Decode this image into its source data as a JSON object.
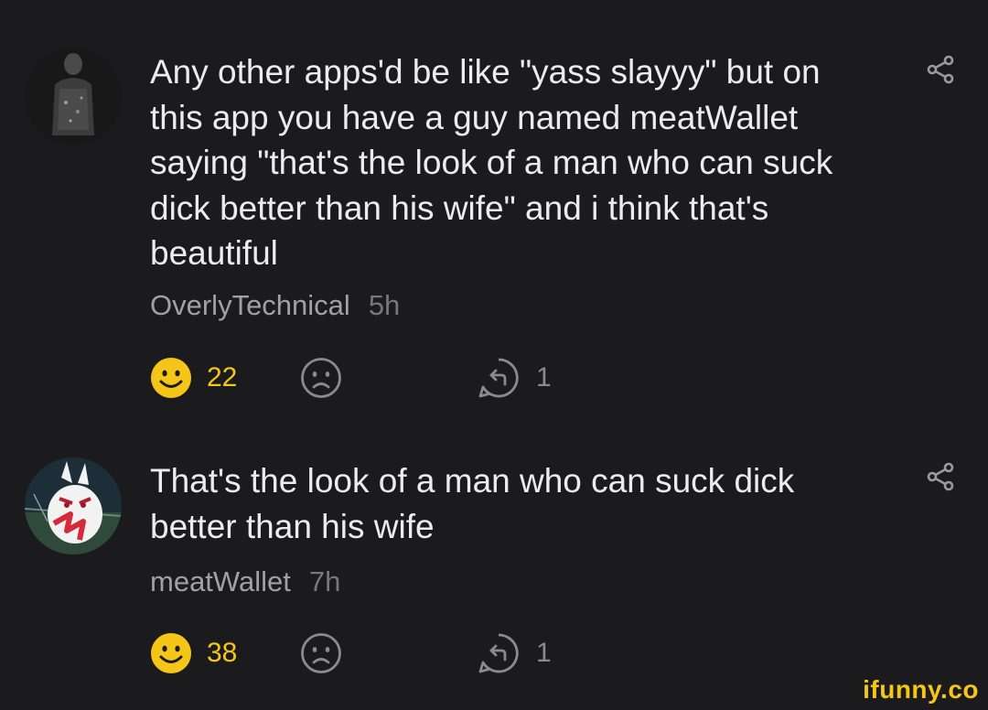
{
  "comments": [
    {
      "text": "Any other apps'd be like \"yass slayyy\" but on this app you have a guy named meatWallet saying \"that's the look of a man who can suck dick better than his wife\" and i think that's beautiful",
      "author": "OverlyTechnical",
      "time": "5h",
      "likes": "22",
      "replies": "1"
    },
    {
      "text": "That's the look of a man who can suck dick better than his wife",
      "author": "meatWallet",
      "time": "7h",
      "likes": "38",
      "replies": "1"
    }
  ],
  "watermark": "ifunny.co",
  "colors": {
    "background": "#1b1b1e",
    "like": "#f5c518",
    "text": "#ececec",
    "muted": "#a0a0a6"
  },
  "icons": [
    "avatar",
    "share-icon",
    "smile-icon",
    "frown-icon",
    "reply-icon"
  ]
}
